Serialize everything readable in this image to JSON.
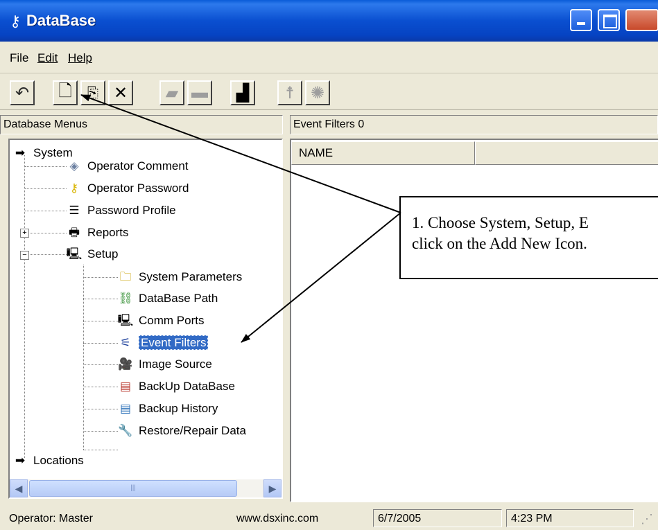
{
  "window": {
    "title": "DataBase",
    "icon": "key-app-icon"
  },
  "menu": [
    {
      "label": "File"
    },
    {
      "label": "Edit"
    },
    {
      "label": "Help"
    }
  ],
  "toolbar": {
    "tools": [
      "undo-icon",
      "new-document-icon",
      "copy-icon",
      "delete-icon",
      "print-icon",
      "link-icon",
      "chart-icon",
      "person-icon",
      "group-icon"
    ]
  },
  "left_header": "Database Menus",
  "right_header": "Event Filters  0",
  "tree": {
    "system": "System",
    "operator_comment": "Operator Comment",
    "operator_password": "Operator Password",
    "password_profile": "Password Profile",
    "reports": "Reports",
    "setup": "Setup",
    "system_parameters": "System Parameters",
    "database_path": "DataBase Path",
    "comm_ports": "Comm Ports",
    "event_filters": "Event Filters",
    "image_source": "Image Source",
    "backup_database": "BackUp DataBase",
    "backup_history": "Backup History",
    "restore_repair": "Restore/Repair Data",
    "locations": "Locations",
    "expand_symbol": "+",
    "collapse_symbol": "−"
  },
  "list": {
    "col_name": "NAME"
  },
  "callout": {
    "line1": "1. Choose System, Setup, E",
    "line2": "click on the Add New Icon."
  },
  "status": {
    "operator": "Operator:  Master",
    "website": "www.dsxinc.com",
    "date": "6/7/2005",
    "time": "4:23 PM"
  }
}
